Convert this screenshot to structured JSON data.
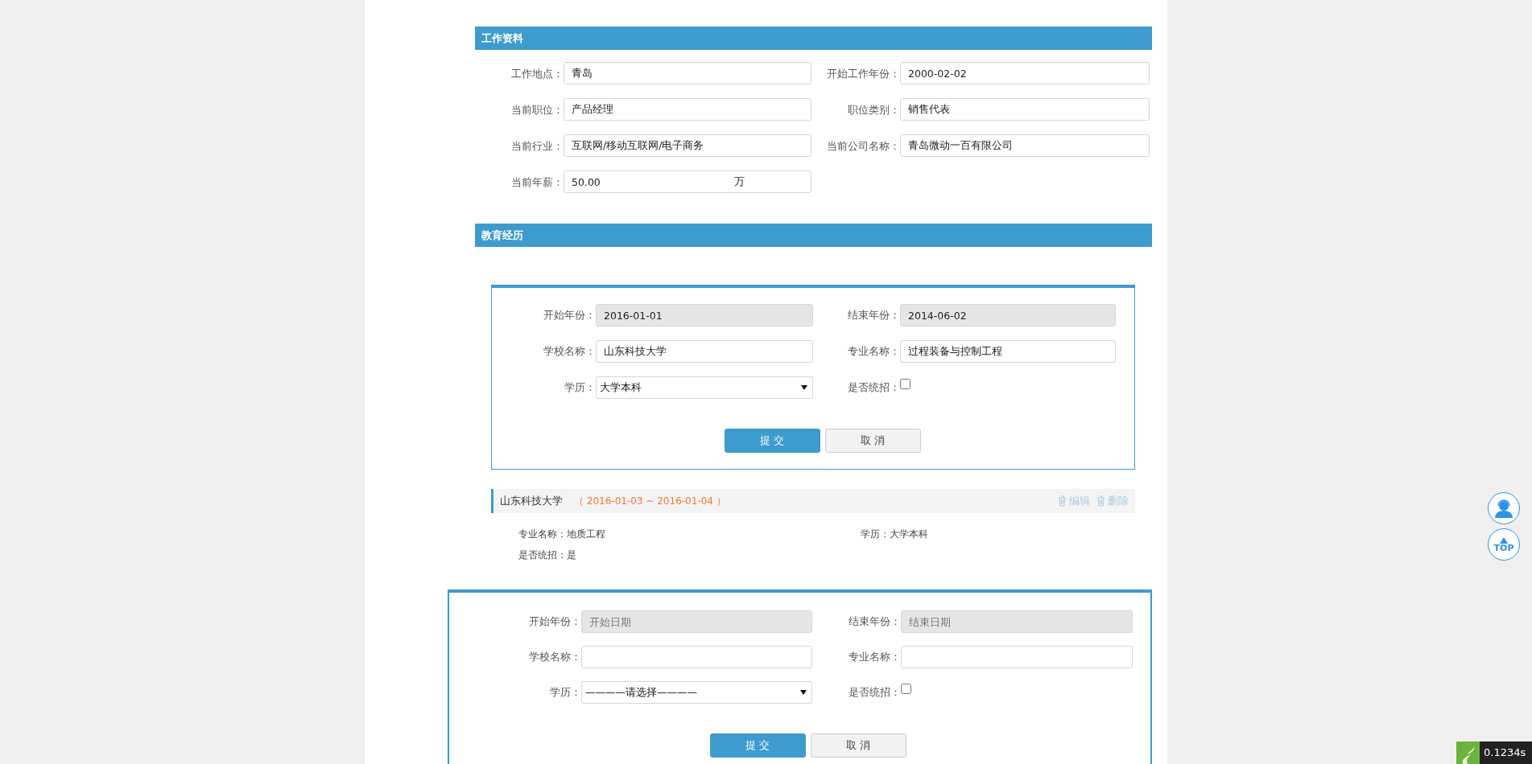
{
  "work_section": {
    "title": "工作资料",
    "fields": [
      {
        "label": "工作地点：",
        "value": "青岛",
        "kind": "text"
      },
      {
        "label": "开始工作年份：",
        "value": "2000-02-02",
        "kind": "text"
      },
      {
        "label": "当前职位：",
        "value": "产品经理",
        "kind": "text"
      },
      {
        "label": "职位类别：",
        "value": "销售代表",
        "kind": "text"
      },
      {
        "label": "当前行业：",
        "value": "互联网/移动互联网/电子商务",
        "kind": "text"
      },
      {
        "label": "当前公司名称：",
        "value": "青岛微动一百有限公司",
        "kind": "text"
      },
      {
        "label": "当前年薪：",
        "value": "50.00",
        "unit": "万",
        "kind": "unit"
      }
    ]
  },
  "education_section": {
    "title": "教育经历",
    "blocks": [
      {
        "kind": "edit_form",
        "fields": [
          {
            "label": "开始年份：",
            "value": "2016-01-01",
            "kind": "date"
          },
          {
            "label": "结束年份：",
            "value": "2014-06-02",
            "kind": "date"
          },
          {
            "label": "学校名称：",
            "value": "山东科技大学",
            "kind": "text"
          },
          {
            "label": "专业名称：",
            "value": "过程装备与控制工程",
            "kind": "text"
          },
          {
            "label": "学历：",
            "value": "大学本科",
            "kind": "select"
          },
          {
            "label": "是否统招：",
            "checked": false,
            "kind": "checkbox"
          }
        ],
        "submit": "提 交",
        "cancel": "取 消"
      },
      {
        "kind": "entry",
        "school": "山东科技大学",
        "period": "（ 2016-01-03 ~ 2016-01-04 ）",
        "edit": "编辑",
        "delete": "删除",
        "details": [
          "专业名称：地质工程",
          "学历：大学本科",
          "是否统招：是"
        ]
      },
      {
        "kind": "new_form",
        "fields": [
          {
            "label": "开始年份：",
            "placeholder": "开始日期",
            "kind": "date"
          },
          {
            "label": "结束年份：",
            "placeholder": "结束日期",
            "kind": "date"
          },
          {
            "label": "学校名称：",
            "kind": "text"
          },
          {
            "label": "专业名称：",
            "kind": "text"
          },
          {
            "label": "学历：",
            "value": "————请选择————",
            "kind": "select"
          },
          {
            "label": "是否统招：",
            "checked": false,
            "kind": "checkbox"
          }
        ],
        "submit": "提 交",
        "cancel": "取 消"
      }
    ]
  },
  "float_tools": {
    "top_label": "TOP"
  },
  "perf_badge": {
    "time": "0.1234s"
  }
}
